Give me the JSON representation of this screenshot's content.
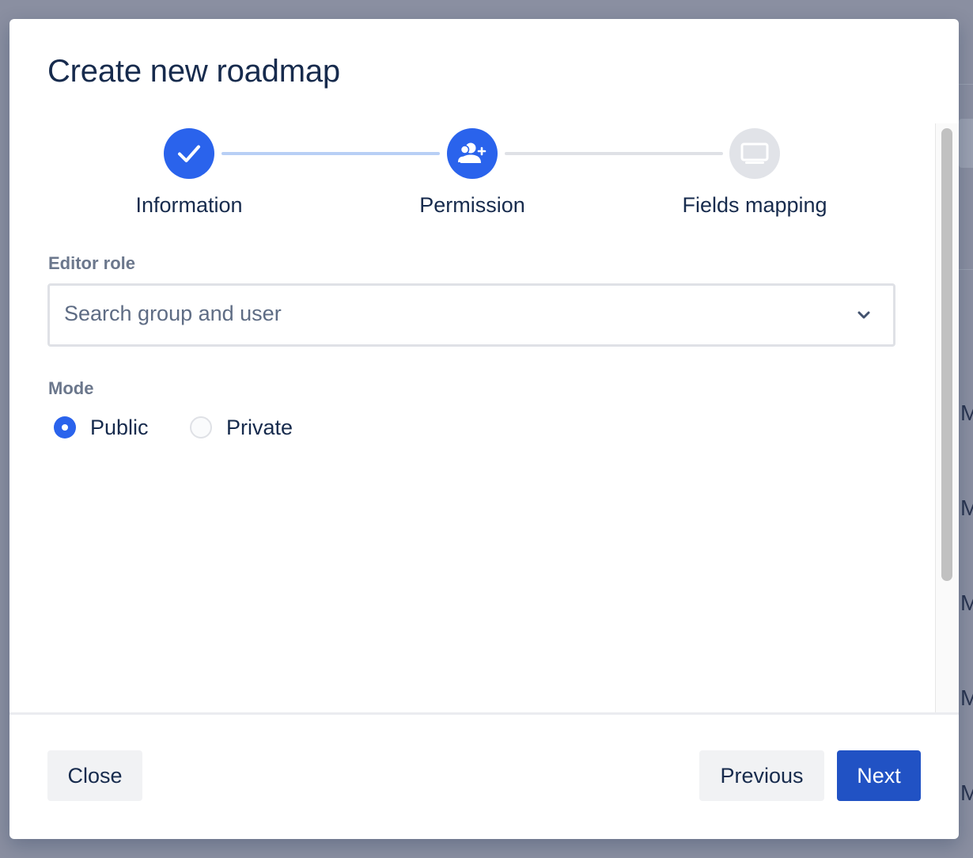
{
  "modal": {
    "title": "Create new roadmap"
  },
  "stepper": {
    "steps": [
      {
        "label": "Information",
        "status": "completed",
        "icon": "checkmark-icon"
      },
      {
        "label": "Permission",
        "status": "active",
        "icon": "user-add-icon"
      },
      {
        "label": "Fields mapping",
        "status": "pending",
        "icon": "monitor-icon"
      }
    ]
  },
  "form": {
    "editor_role": {
      "label": "Editor role",
      "placeholder": "Search group and user",
      "icon": "chevron-down-icon"
    },
    "mode": {
      "label": "Mode",
      "options": [
        {
          "label": "Public",
          "checked": true
        },
        {
          "label": "Private",
          "checked": false
        }
      ]
    }
  },
  "footer": {
    "close_label": "Close",
    "previous_label": "Previous",
    "next_label": "Next"
  },
  "colors": {
    "primary": "#2a63ec",
    "next_button": "#2152c4",
    "text_dark": "#172b4d",
    "text_muted": "#6b778c",
    "overlay": "#8a8fa1"
  }
}
